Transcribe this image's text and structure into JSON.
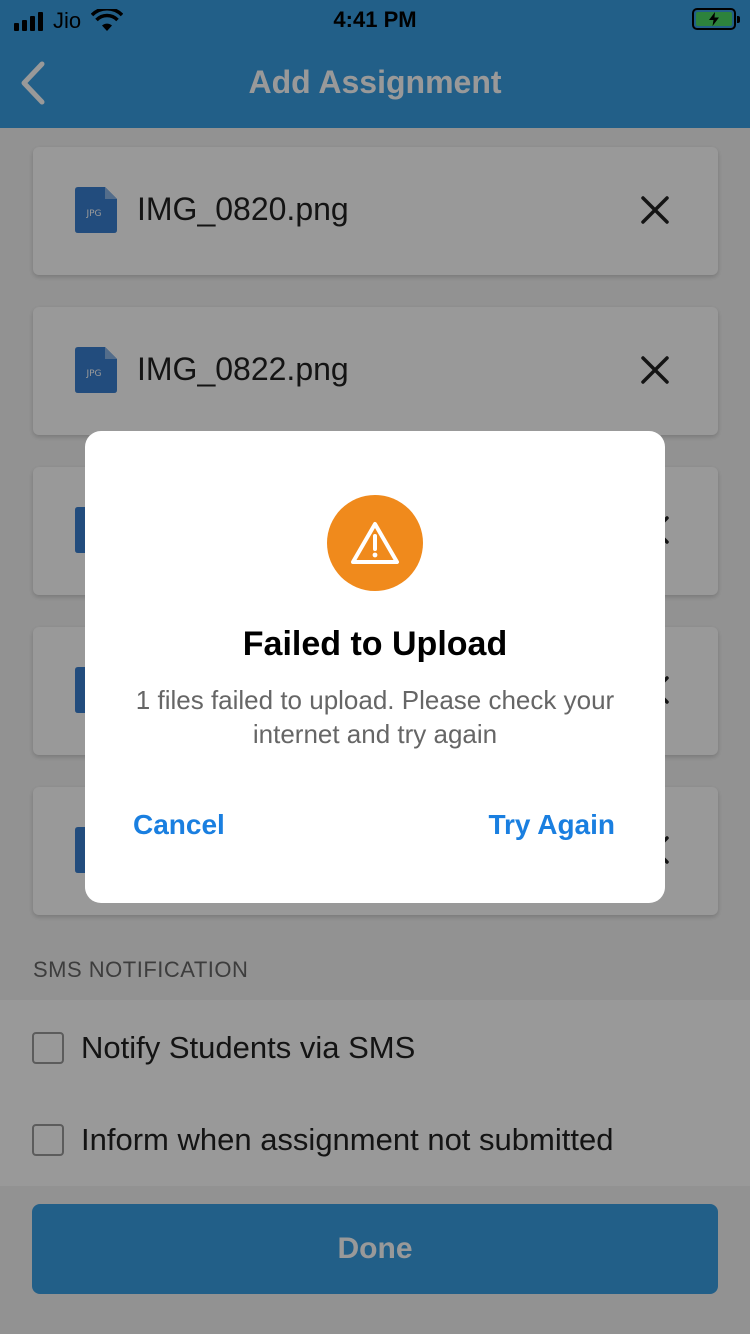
{
  "status_bar": {
    "carrier": "Jio",
    "time": "4:41 PM",
    "battery_state": "charging"
  },
  "nav": {
    "title": "Add Assignment",
    "back_icon": "chevron-left-icon"
  },
  "attachments": [
    {
      "file_name": "IMG_0820.png",
      "icon_label": "JPG"
    },
    {
      "file_name": "IMG_0822.png",
      "icon_label": "JPG"
    },
    {
      "file_name": "",
      "icon_label": ""
    },
    {
      "file_name": "",
      "icon_label": ""
    },
    {
      "file_name": "",
      "icon_label": ""
    }
  ],
  "sms_section": {
    "header": "SMS NOTIFICATION",
    "options": [
      {
        "label": "Notify Students via SMS",
        "checked": false
      },
      {
        "label": "Inform when assignment not submitted",
        "checked": false
      }
    ]
  },
  "done_label": "Done",
  "dialog": {
    "icon": "warning-icon",
    "title": "Failed to Upload",
    "message": "1 files failed to upload. Please check your internet and try again",
    "cancel_label": "Cancel",
    "retry_label": "Try Again"
  },
  "colors": {
    "brand_blue": "#3a9ee3",
    "warning_orange": "#f08a1c",
    "link_blue": "#1a7fe0"
  }
}
